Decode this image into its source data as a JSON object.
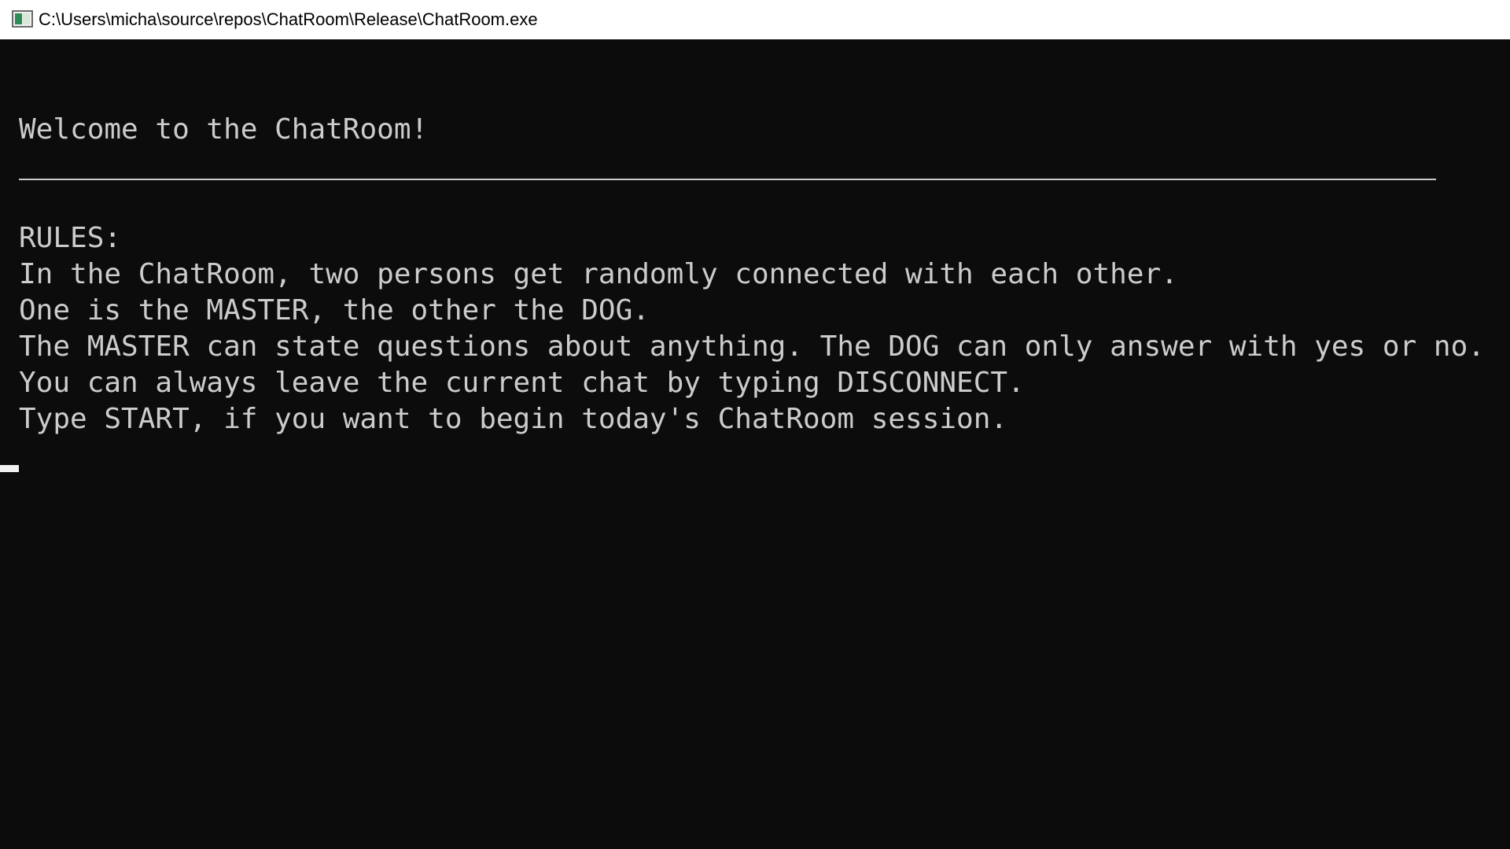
{
  "window": {
    "title": "C:\\Users\\micha\\source\\repos\\ChatRoom\\Release\\ChatRoom.exe",
    "icon": "console-app-icon"
  },
  "console": {
    "welcome": "Welcome to the ChatRoom!",
    "rules_heading": "RULES:",
    "rules": [
      "In the ChatRoom, two persons get randomly connected with each other.",
      "One is the MASTER, the other the DOG.",
      "The MASTER can state questions about anything. The DOG can only answer with yes or no.",
      "You can always leave the current chat by typing DISCONNECT.",
      "Type START, if you want to begin today's ChatRoom session."
    ],
    "colors": {
      "background": "#0c0c0c",
      "foreground": "#cccccc"
    }
  }
}
